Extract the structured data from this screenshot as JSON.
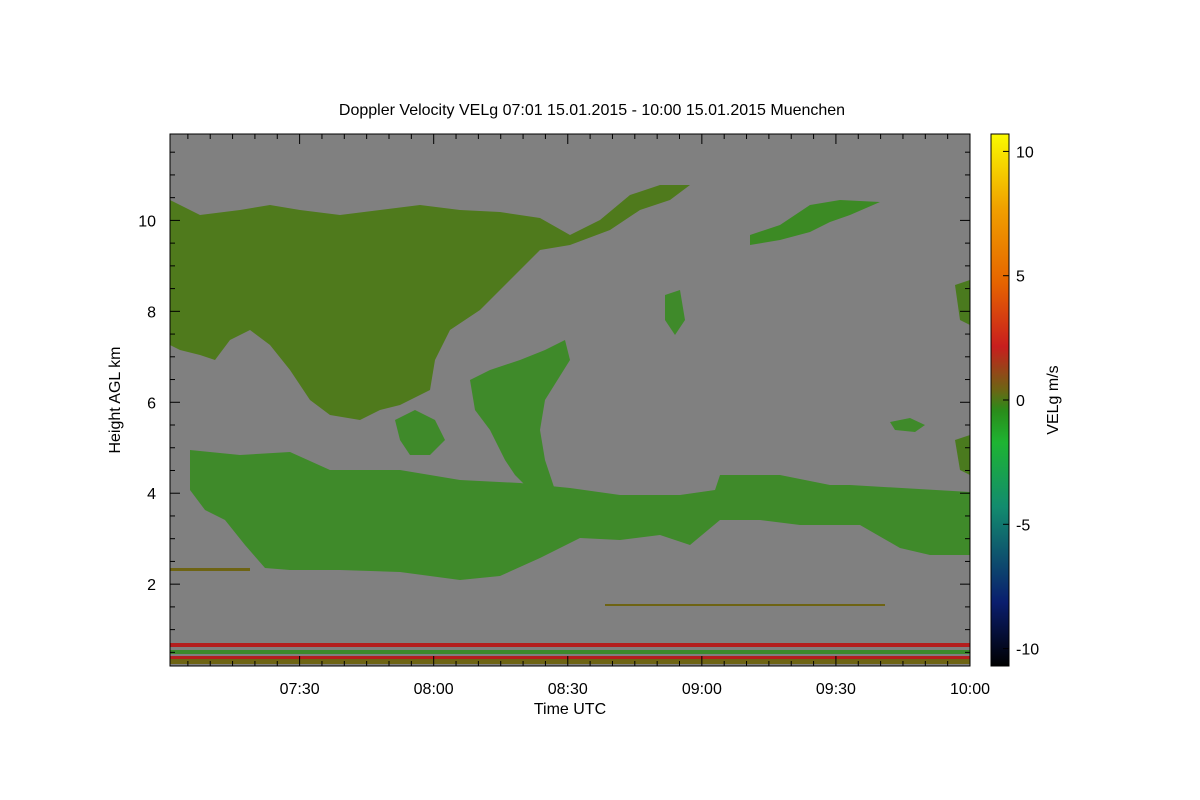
{
  "chart_data": {
    "type": "heatmap",
    "title": "Doppler Velocity VELg   07:01 15.01.2015 - 10:00 15.01.2015 Muenchen",
    "xlabel": "Time UTC",
    "ylabel": "Height AGL km",
    "xlim": [
      "07:01",
      "10:00"
    ],
    "x_ticks": [
      "07:30",
      "08:00",
      "08:30",
      "09:00",
      "09:30",
      "10:00"
    ],
    "ylim": [
      0.2,
      11.9
    ],
    "y_ticks": [
      2,
      4,
      6,
      8,
      10
    ],
    "colorbar": {
      "label": "VELg m/s",
      "range": [
        -10.7,
        10.7
      ],
      "ticks": [
        -10,
        -5,
        0,
        5,
        10
      ],
      "colors": [
        "#000000",
        "#0a1e6e",
        "#128c6e",
        "#1eb432",
        "#2a8c1a",
        "#6e6414",
        "#c81e1e",
        "#e66400",
        "#f0a000",
        "#fafa00"
      ]
    },
    "background_color": "#808080",
    "echo_regions": [
      {
        "description": "upper cloud",
        "t_start": "07:01",
        "t_end": "08:57",
        "base_km": 4.8,
        "top_km": 10.8
      },
      {
        "description": "mid-level layer",
        "t_start": "07:05",
        "t_end": "10:00",
        "base_km": 2.1,
        "top_km": 5.0
      },
      {
        "description": "fall streak",
        "t_start": "08:08",
        "t_end": "08:45",
        "base_km": 4.0,
        "top_km": 7.4
      },
      {
        "description": "upper patch",
        "t_start": "09:12",
        "t_end": "09:42",
        "base_km": 9.2,
        "top_km": 10.5
      },
      {
        "description": "near-surface clutter",
        "t_start": "07:01",
        "t_end": "10:00",
        "base_km": 0.2,
        "top_km": 0.7
      }
    ]
  }
}
